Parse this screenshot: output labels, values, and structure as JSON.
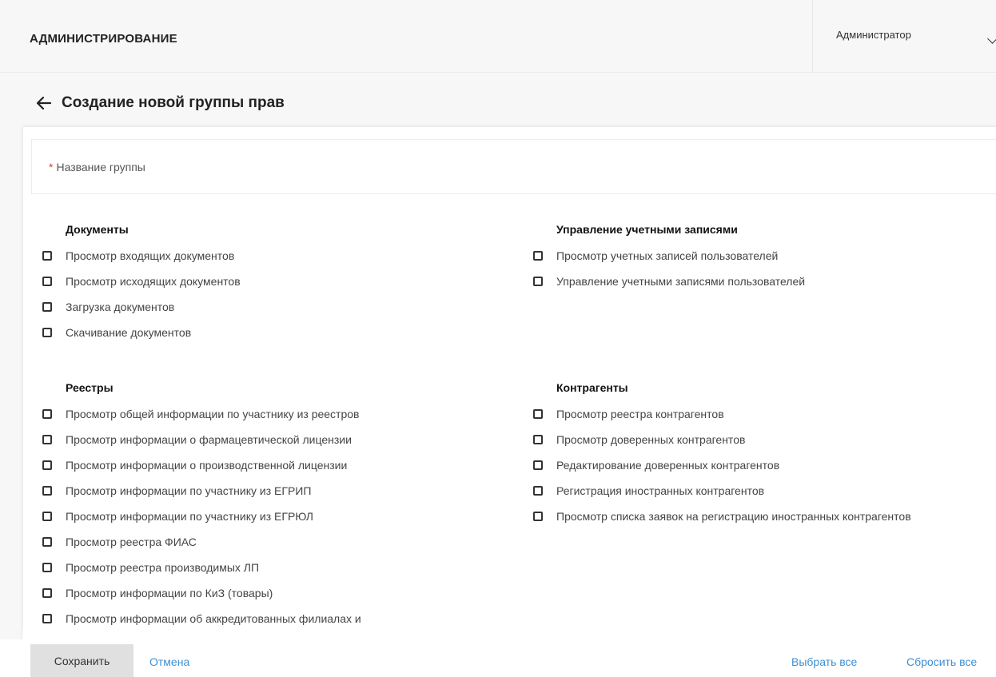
{
  "header": {
    "title": "АДМИНИСТРИРОВАНИЕ",
    "user": "Администратор"
  },
  "page": {
    "title": "Создание новой группы прав"
  },
  "form": {
    "required_mark": "*",
    "name_label": "Название группы",
    "name_value": ""
  },
  "sections": {
    "documents": {
      "title": "Документы",
      "items": [
        "Просмотр входящих документов",
        "Просмотр исходящих документов",
        "Загрузка документов",
        "Скачивание документов"
      ]
    },
    "accounts": {
      "title": "Управление учетными записями",
      "items": [
        "Просмотр учетных записей пользователей",
        "Управление учетными записями пользователей"
      ]
    },
    "registries": {
      "title": "Реестры",
      "items": [
        "Просмотр общей информации по участнику из реестров",
        "Просмотр информации о фармацевтической лицензии",
        "Просмотр информации о производственной лицензии",
        "Просмотр информации по участнику из ЕГРИП",
        "Просмотр информации по участнику из ЕГРЮЛ",
        "Просмотр реестра ФИАС",
        "Просмотр реестра производимых ЛП",
        "Просмотр информации по КиЗ (товары)",
        "Просмотр информации об аккредитованных филиалах и"
      ]
    },
    "contractors": {
      "title": "Контрагенты",
      "items": [
        "Просмотр реестра контрагентов",
        "Просмотр доверенных контрагентов",
        "Редактирование доверенных контрагентов",
        "Регистрация иностранных контрагентов",
        "Просмотр списка заявок на регистрацию иностранных контрагентов"
      ]
    }
  },
  "actions": {
    "save": "Сохранить",
    "cancel": "Отмена",
    "select_all": "Выбрать все",
    "reset_all": "Сбросить все"
  },
  "colors": {
    "link": "#3d8fd6",
    "required": "#e53935",
    "save_button_bg": "#e0e0e0"
  }
}
